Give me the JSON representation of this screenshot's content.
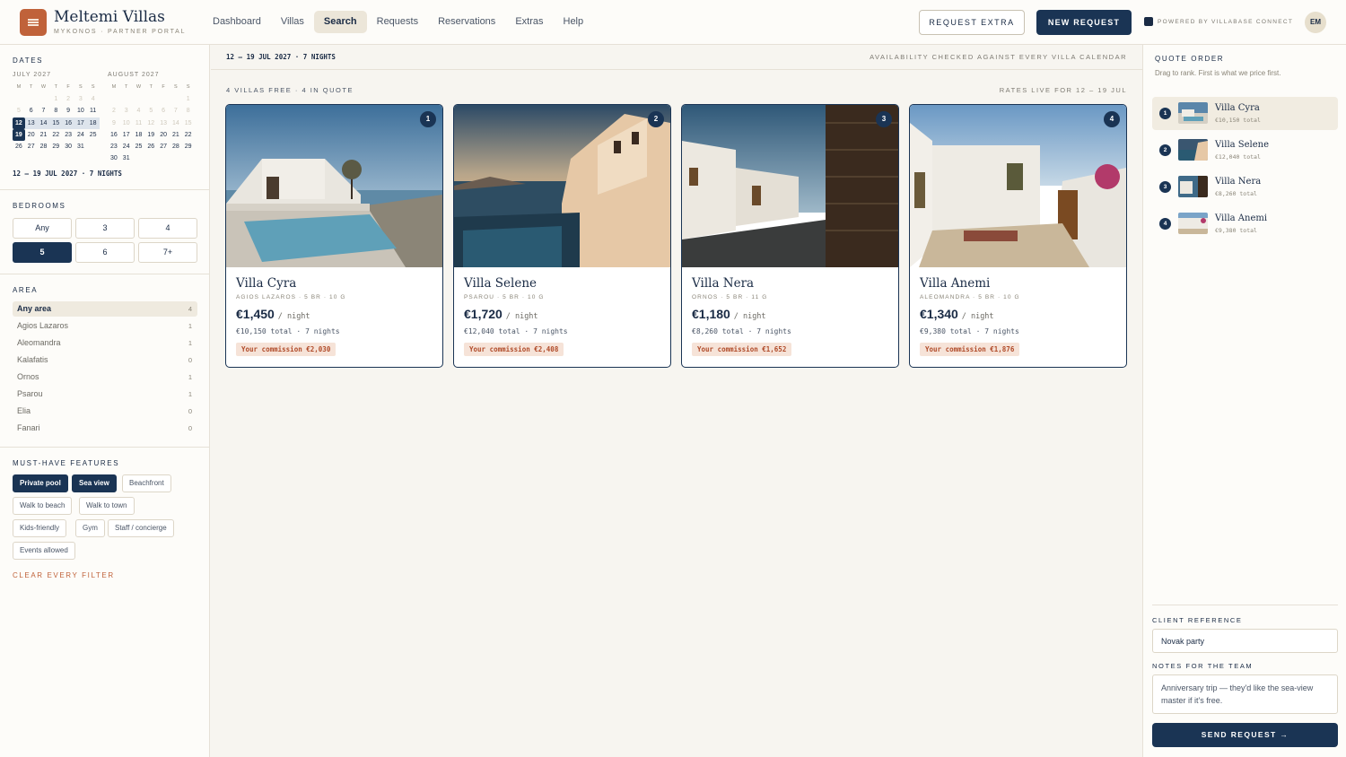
{
  "brand": {
    "name": "Meltemi Villas",
    "subtitle": "MYKONOS · PARTNER PORTAL",
    "logo_icon": "menu-lines-icon"
  },
  "nav": [
    {
      "label": "Dashboard",
      "active": false
    },
    {
      "label": "Villas",
      "active": false
    },
    {
      "label": "Search",
      "active": true
    },
    {
      "label": "Requests",
      "active": false
    },
    {
      "label": "Reservations",
      "active": false
    },
    {
      "label": "Extras",
      "active": false
    },
    {
      "label": "Help",
      "active": false
    }
  ],
  "header": {
    "request_extra": "REQUEST EXTRA",
    "new_request": "NEW REQUEST",
    "powered_by": "POWERED BY VILLABASE CONNECT",
    "avatar": "EM"
  },
  "filters": {
    "dates_label": "DATES",
    "weekdays": [
      "M",
      "T",
      "W",
      "T",
      "F",
      "S",
      "S"
    ],
    "calendars": [
      {
        "title": "JULY 2027",
        "offset": 3,
        "days": 31,
        "selected": [
          12,
          19
        ],
        "range": [
          13,
          18
        ],
        "min": 6,
        "max": 31
      },
      {
        "title": "AUGUST 2027",
        "offset": 6,
        "days": 31,
        "selected": [],
        "range": [],
        "min": 16,
        "max": 31
      }
    ],
    "date_summary": "12 – 19 JUL 2027 · 7 NIGHTS",
    "bedrooms_label": "BEDROOMS",
    "bedrooms": [
      {
        "label": "Any",
        "active": false
      },
      {
        "label": "3",
        "active": false
      },
      {
        "label": "4",
        "active": false
      },
      {
        "label": "5",
        "active": true
      },
      {
        "label": "6",
        "active": false
      },
      {
        "label": "7+",
        "active": false
      }
    ],
    "area_label": "AREA",
    "areas": [
      {
        "name": "Any area",
        "count": "4",
        "active": true
      },
      {
        "name": "Agios Lazaros",
        "count": "1",
        "active": false
      },
      {
        "name": "Aleomandra",
        "count": "1",
        "active": false
      },
      {
        "name": "Kalafatis",
        "count": "0",
        "active": false
      },
      {
        "name": "Ornos",
        "count": "1",
        "active": false
      },
      {
        "name": "Psarou",
        "count": "1",
        "active": false
      },
      {
        "name": "Elia",
        "count": "0",
        "active": false
      },
      {
        "name": "Fanari",
        "count": "0",
        "active": false
      }
    ],
    "features_label": "MUST-HAVE FEATURES",
    "features": [
      {
        "label": "Private pool",
        "active": true
      },
      {
        "label": "Sea view",
        "active": true
      },
      {
        "label": "Beachfront",
        "active": false
      },
      {
        "label": "Walk to beach",
        "active": false
      },
      {
        "label": "Walk to town",
        "active": false
      },
      {
        "label": "Kids-friendly",
        "active": false
      },
      {
        "label": "Gym",
        "active": false
      },
      {
        "label": "Staff / concierge",
        "active": false
      },
      {
        "label": "Events allowed",
        "active": false
      }
    ],
    "clear": "CLEAR EVERY FILTER"
  },
  "main": {
    "dates": "12 – 19 JUL 2027 · 7 NIGHTS",
    "availability": "AVAILABILITY CHECKED AGAINST EVERY VILLA CALENDAR",
    "count": "4 VILLAS FREE · 4 IN QUOTE",
    "rates": "RATES LIVE FOR 12 – 19 JUL",
    "villas": [
      {
        "rank": "1",
        "name": "Villa Cyra",
        "meta": "AGIOS LAZAROS · 5 BR · 10 G",
        "price": "€1,450",
        "per": "/ night",
        "total": "€10,150 total · 7 nights",
        "commission": "Your commission €2,030"
      },
      {
        "rank": "2",
        "name": "Villa Selene",
        "meta": "PSAROU · 5 BR · 10 G",
        "price": "€1,720",
        "per": "/ night",
        "total": "€12,040 total · 7 nights",
        "commission": "Your commission €2,408"
      },
      {
        "rank": "3",
        "name": "Villa Nera",
        "meta": "ORNOS · 5 BR · 11 G",
        "price": "€1,180",
        "per": "/ night",
        "total": "€8,260 total · 7 nights",
        "commission": "Your commission €1,652"
      },
      {
        "rank": "4",
        "name": "Villa Anemi",
        "meta": "ALEOMANDRA · 5 BR · 10 G",
        "price": "€1,340",
        "per": "/ night",
        "total": "€9,380 total · 7 nights",
        "commission": "Your commission €1,876"
      }
    ]
  },
  "quote": {
    "title": "QUOTE ORDER",
    "subtitle": "Drag to rank. First is what we price first.",
    "items": [
      {
        "rank": "1",
        "name": "Villa Cyra",
        "total": "€10,150 total"
      },
      {
        "rank": "2",
        "name": "Villa Selene",
        "total": "€12,040 total"
      },
      {
        "rank": "3",
        "name": "Villa Nera",
        "total": "€8,260 total"
      },
      {
        "rank": "4",
        "name": "Villa Anemi",
        "total": "€9,380 total"
      }
    ],
    "client_ref_label": "CLIENT REFERENCE",
    "client_ref_value": "Novak party",
    "notes_label": "NOTES FOR THE TEAM",
    "notes_value": "Anniversary trip — they'd like the sea-view master if it's free.",
    "send": "SEND REQUEST →"
  },
  "colors": {
    "navy": "#1a3454",
    "terracotta": "#c0623a",
    "cream": "#f7f5f0",
    "commission_bg": "#f6e3d8"
  }
}
